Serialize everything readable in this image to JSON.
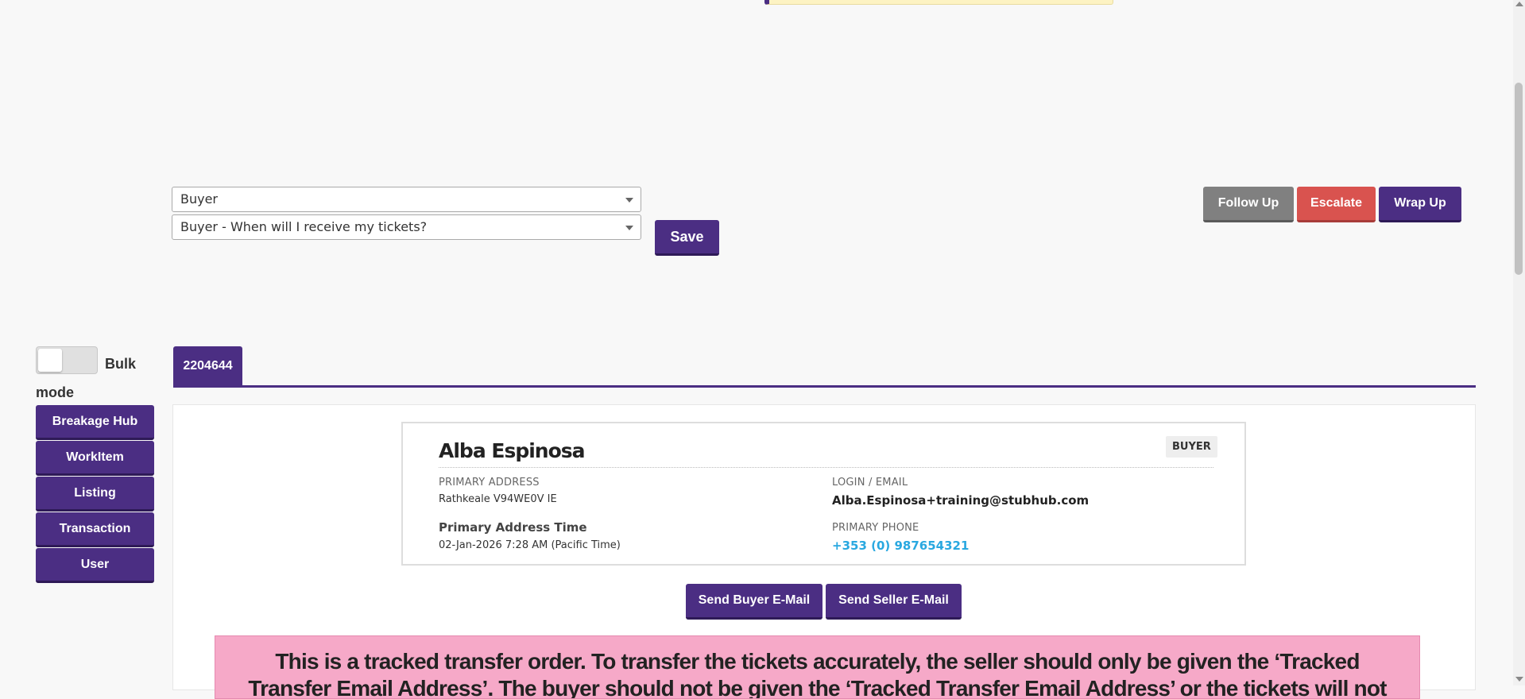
{
  "dropdowns": {
    "party": {
      "selected": "Buyer"
    },
    "reason": {
      "selected": "Buyer - When will I receive my tickets?"
    }
  },
  "buttons": {
    "save": "Save",
    "follow_up": "Follow Up",
    "escalate": "Escalate",
    "wrap_up": "Wrap Up",
    "send_buyer_email": "Send Buyer E-Mail",
    "send_seller_email": "Send Seller E-Mail"
  },
  "sidebar": {
    "toggle_label": "Bulk mode",
    "items": [
      {
        "label": "Breakage Hub"
      },
      {
        "label": "WorkItem"
      },
      {
        "label": "Listing"
      },
      {
        "label": "Transaction"
      },
      {
        "label": "User"
      }
    ]
  },
  "tabs": [
    {
      "label": "2204644"
    }
  ],
  "customer": {
    "name": "Alba Espinosa",
    "role_badge": "BUYER",
    "primary_address_label": "PRIMARY ADDRESS",
    "primary_address": "Rathkeale V94WE0V IE",
    "primary_address_time_label": "Primary Address Time",
    "primary_address_time": "02-Jan-2026 7:28 AM (Pacific Time)",
    "login_label": "LOGIN / EMAIL",
    "login_email": "Alba.Espinosa+training@stubhub.com",
    "phone_label": "PRIMARY PHONE",
    "phone": "+353 (0) 987654321"
  },
  "alert": {
    "text": "This is a tracked transfer order. To transfer the tickets accurately, the seller should only be given the ‘Tracked Transfer Email Address’. The buyer should not be given the ‘Tracked Transfer Email Address’ or the tickets will not automatically be sent to the"
  },
  "colors": {
    "primary_purple": "#4b2e83",
    "escalate_red": "#d9534f",
    "follow_up_grey": "#808080",
    "alert_pink": "#f6a9c8",
    "phone_blue": "#29a8e0"
  }
}
